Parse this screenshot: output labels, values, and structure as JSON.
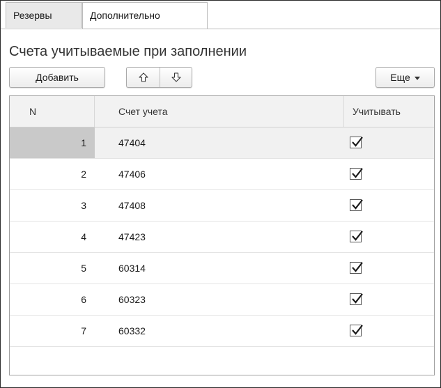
{
  "tabs": [
    {
      "label": "Резервы"
    },
    {
      "label": "Дополнительно"
    }
  ],
  "section": {
    "title": "Счета учитываемые при заполнении"
  },
  "toolbar": {
    "add_label": "Добавить",
    "move_up_icon": "arrow-up-icon",
    "move_down_icon": "arrow-down-icon",
    "more_label": "Еще"
  },
  "table": {
    "columns": {
      "n": "N",
      "account": "Счет учета",
      "use": "Учитывать"
    },
    "rows": [
      {
        "n": "1",
        "account": "47404",
        "use": true
      },
      {
        "n": "2",
        "account": "47406",
        "use": true
      },
      {
        "n": "3",
        "account": "47408",
        "use": true
      },
      {
        "n": "4",
        "account": "47423",
        "use": true
      },
      {
        "n": "5",
        "account": "60314",
        "use": true
      },
      {
        "n": "6",
        "account": "60323",
        "use": true
      },
      {
        "n": "7",
        "account": "60332",
        "use": true
      }
    ],
    "selected_row": 1
  }
}
